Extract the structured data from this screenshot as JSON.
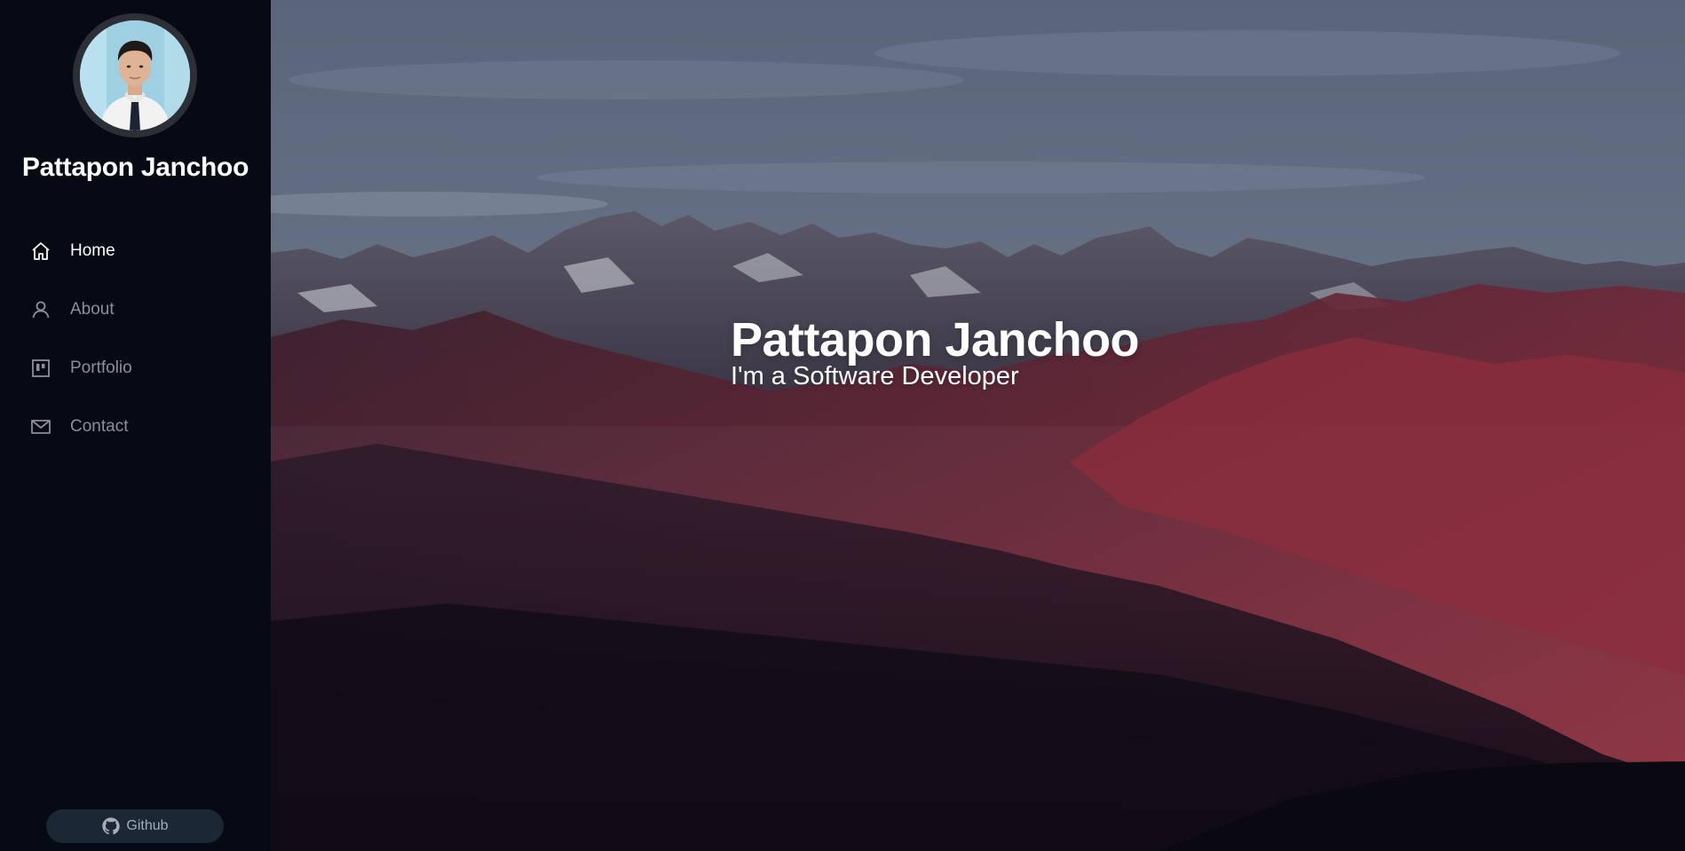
{
  "profile": {
    "name": "Pattapon Janchoo",
    "avatar_icon": "profile-photo"
  },
  "nav": {
    "items": [
      {
        "label": "Home",
        "icon": "home-icon",
        "active": true
      },
      {
        "label": "About",
        "icon": "user-icon",
        "active": false
      },
      {
        "label": "Portfolio",
        "icon": "portfolio-icon",
        "active": false
      },
      {
        "label": "Contact",
        "icon": "mail-icon",
        "active": false
      }
    ]
  },
  "footer": {
    "github_label": "Github",
    "github_icon": "github-icon"
  },
  "hero": {
    "title": "Pattapon Janchoo",
    "subtitle": "I'm a Software Developer",
    "background": "mountain-landscape"
  },
  "colors": {
    "sidebar_bg": "#050a14",
    "nav_active": "#ffffff",
    "nav_inactive": "#8b8f97",
    "github_btn_bg": "#1c2736"
  }
}
